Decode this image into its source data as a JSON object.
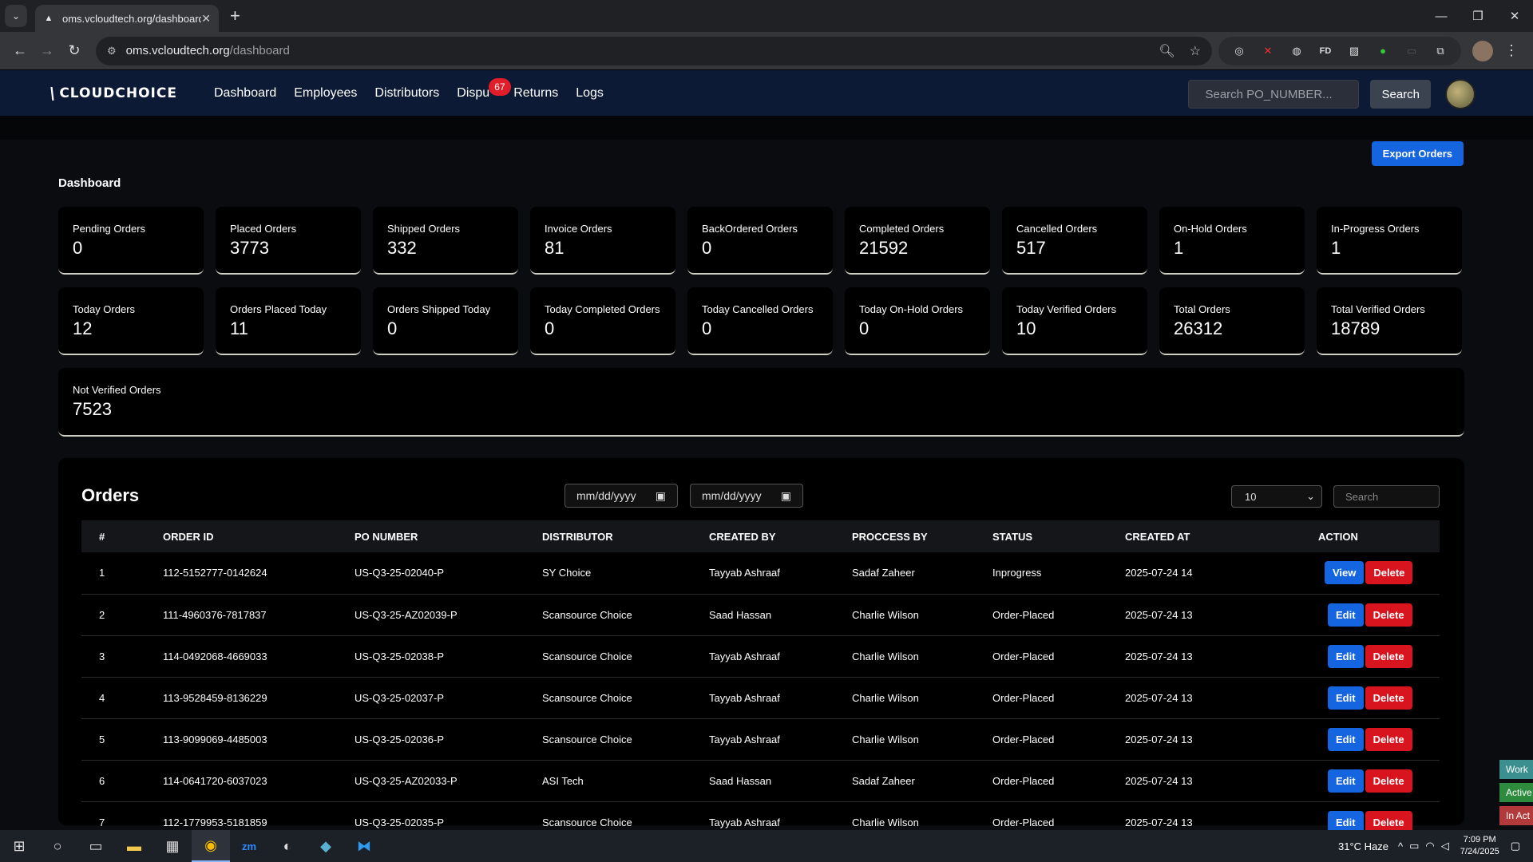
{
  "browser": {
    "tab_title": "oms.vcloudtech.org/dashboard",
    "url_host": "oms.vcloudtech.org",
    "url_path": "/dashboard"
  },
  "nav": {
    "logo_text": "CLOUDCHOICE",
    "links": [
      "Dashboard",
      "Employees",
      "Distributors",
      "Dispu",
      "Returns",
      "Logs"
    ],
    "disputes_badge": "67",
    "search_placeholder": "Search PO_NUMBER...",
    "search_button": "Search"
  },
  "dashboard": {
    "export_button": "Export Orders",
    "title": "Dashboard",
    "cards": [
      {
        "label": "Pending Orders",
        "value": "0"
      },
      {
        "label": "Placed Orders",
        "value": "3773"
      },
      {
        "label": "Shipped Orders",
        "value": "332"
      },
      {
        "label": "Invoice Orders",
        "value": "81"
      },
      {
        "label": "BackOrdered Orders",
        "value": "0"
      },
      {
        "label": "Completed Orders",
        "value": "21592"
      },
      {
        "label": "Cancelled Orders",
        "value": "517"
      },
      {
        "label": "On-Hold Orders",
        "value": "1"
      },
      {
        "label": "In-Progress Orders",
        "value": "1"
      },
      {
        "label": "Today Orders",
        "value": "12"
      },
      {
        "label": "Orders Placed Today",
        "value": "11"
      },
      {
        "label": "Orders Shipped Today",
        "value": "0"
      },
      {
        "label": "Today Completed Orders",
        "value": "0"
      },
      {
        "label": "Today Cancelled Orders",
        "value": "0"
      },
      {
        "label": "Today On-Hold Orders",
        "value": "0"
      },
      {
        "label": "Today Verified Orders",
        "value": "10"
      },
      {
        "label": "Total Orders",
        "value": "26312"
      },
      {
        "label": "Total Verified Orders",
        "value": "18789"
      }
    ],
    "not_verified": {
      "label": "Not Verified Orders",
      "value": "7523"
    }
  },
  "orders": {
    "title": "Orders",
    "date_from": "mm/dd/yyyy",
    "date_to": "mm/dd/yyyy",
    "page_length": "10",
    "search_placeholder": "Search",
    "columns": [
      "#",
      "ORDER ID",
      "PO NUMBER",
      "DISTRIBUTOR",
      "CREATED BY",
      "PROCCESS BY",
      "STATUS",
      "CREATED AT",
      "ACTION"
    ],
    "rows": [
      {
        "idx": "1",
        "order_id": "112-5152777-0142624",
        "po": "US-Q3-25-02040-P",
        "distributor": "SY Choice",
        "created_by": "Tayyab Ashraaf",
        "process_by": "Sadaf Zaheer",
        "status": "Inprogress",
        "created_at": "2025-07-24 14",
        "primary_action": "View"
      },
      {
        "idx": "2",
        "order_id": "111-4960376-7817837",
        "po": "US-Q3-25-AZ02039-P",
        "distributor": "Scansource Choice",
        "created_by": "Saad Hassan",
        "process_by": "Charlie Wilson",
        "status": "Order-Placed",
        "created_at": "2025-07-24 13",
        "primary_action": "Edit"
      },
      {
        "idx": "3",
        "order_id": "114-0492068-4669033",
        "po": "US-Q3-25-02038-P",
        "distributor": "Scansource Choice",
        "created_by": "Tayyab Ashraaf",
        "process_by": "Charlie Wilson",
        "status": "Order-Placed",
        "created_at": "2025-07-24 13",
        "primary_action": "Edit"
      },
      {
        "idx": "4",
        "order_id": "113-9528459-8136229",
        "po": "US-Q3-25-02037-P",
        "distributor": "Scansource Choice",
        "created_by": "Tayyab Ashraaf",
        "process_by": "Charlie Wilson",
        "status": "Order-Placed",
        "created_at": "2025-07-24 13",
        "primary_action": "Edit"
      },
      {
        "idx": "5",
        "order_id": "113-9099069-4485003",
        "po": "US-Q3-25-02036-P",
        "distributor": "Scansource Choice",
        "created_by": "Tayyab Ashraaf",
        "process_by": "Charlie Wilson",
        "status": "Order-Placed",
        "created_at": "2025-07-24 13",
        "primary_action": "Edit"
      },
      {
        "idx": "6",
        "order_id": "114-0641720-6037023",
        "po": "US-Q3-25-AZ02033-P",
        "distributor": "ASI Tech",
        "created_by": "Saad Hassan",
        "process_by": "Sadaf Zaheer",
        "status": "Order-Placed",
        "created_at": "2025-07-24 13",
        "primary_action": "Edit"
      },
      {
        "idx": "7",
        "order_id": "112-1779953-5181859",
        "po": "US-Q3-25-02035-P",
        "distributor": "Scansource Choice",
        "created_by": "Tayyab Ashraaf",
        "process_by": "Charlie Wilson",
        "status": "Order-Placed",
        "created_at": "2025-07-24 13",
        "primary_action": "Edit"
      }
    ],
    "delete_label": "Delete"
  },
  "side_tags": [
    {
      "label": "Work",
      "color": "#3b8f8f"
    },
    {
      "label": "Active",
      "color": "#2e8b3e"
    },
    {
      "label": "In Act",
      "color": "#b23a3a"
    }
  ],
  "taskbar": {
    "weather": "31°C  Haze",
    "time": "7:09 PM",
    "date": "7/24/2025"
  }
}
